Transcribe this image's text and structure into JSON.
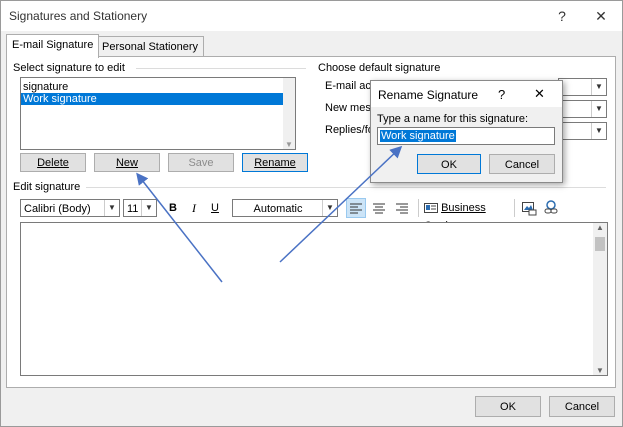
{
  "window": {
    "title": "Signatures and Stationery",
    "help": "?",
    "close": "✕"
  },
  "tabs": [
    {
      "label": "E-mail Signature"
    },
    {
      "label": "Personal Stationery"
    }
  ],
  "select_section": {
    "label": "Select signature to edit",
    "items": [
      "signature",
      "Work signature"
    ],
    "selected_index": 1
  },
  "buttons": {
    "delete": "Delete",
    "new": "New",
    "save": "Save",
    "rename": "Rename"
  },
  "default_section": {
    "label": "Choose default signature",
    "rows": [
      {
        "label": "E-mail acc"
      },
      {
        "label": "New mess"
      },
      {
        "label": "Replies/fo"
      }
    ]
  },
  "edit_section": {
    "label": "Edit signature",
    "font": "Calibri (Body)",
    "size": "11",
    "bold": "B",
    "italic": "I",
    "underline": "U",
    "color": "Automatic",
    "business_card": "Business Card",
    "content": ""
  },
  "footer": {
    "ok": "OK",
    "cancel": "Cancel"
  },
  "rename_dialog": {
    "title": "Rename Signature",
    "help": "?",
    "close": "✕",
    "prompt": "Type a name for this signature:",
    "value": "Work signature",
    "ok": "OK",
    "cancel": "Cancel"
  },
  "colors": {
    "selection": "#0078d7",
    "annotation_arrow": "#4a72c4"
  },
  "icons": [
    "dropdown-arrow-icon",
    "align-left-icon",
    "align-center-icon",
    "align-right-icon",
    "business-card-icon",
    "picture-icon",
    "hyperlink-icon",
    "scroll-up-icon",
    "scroll-down-icon"
  ]
}
